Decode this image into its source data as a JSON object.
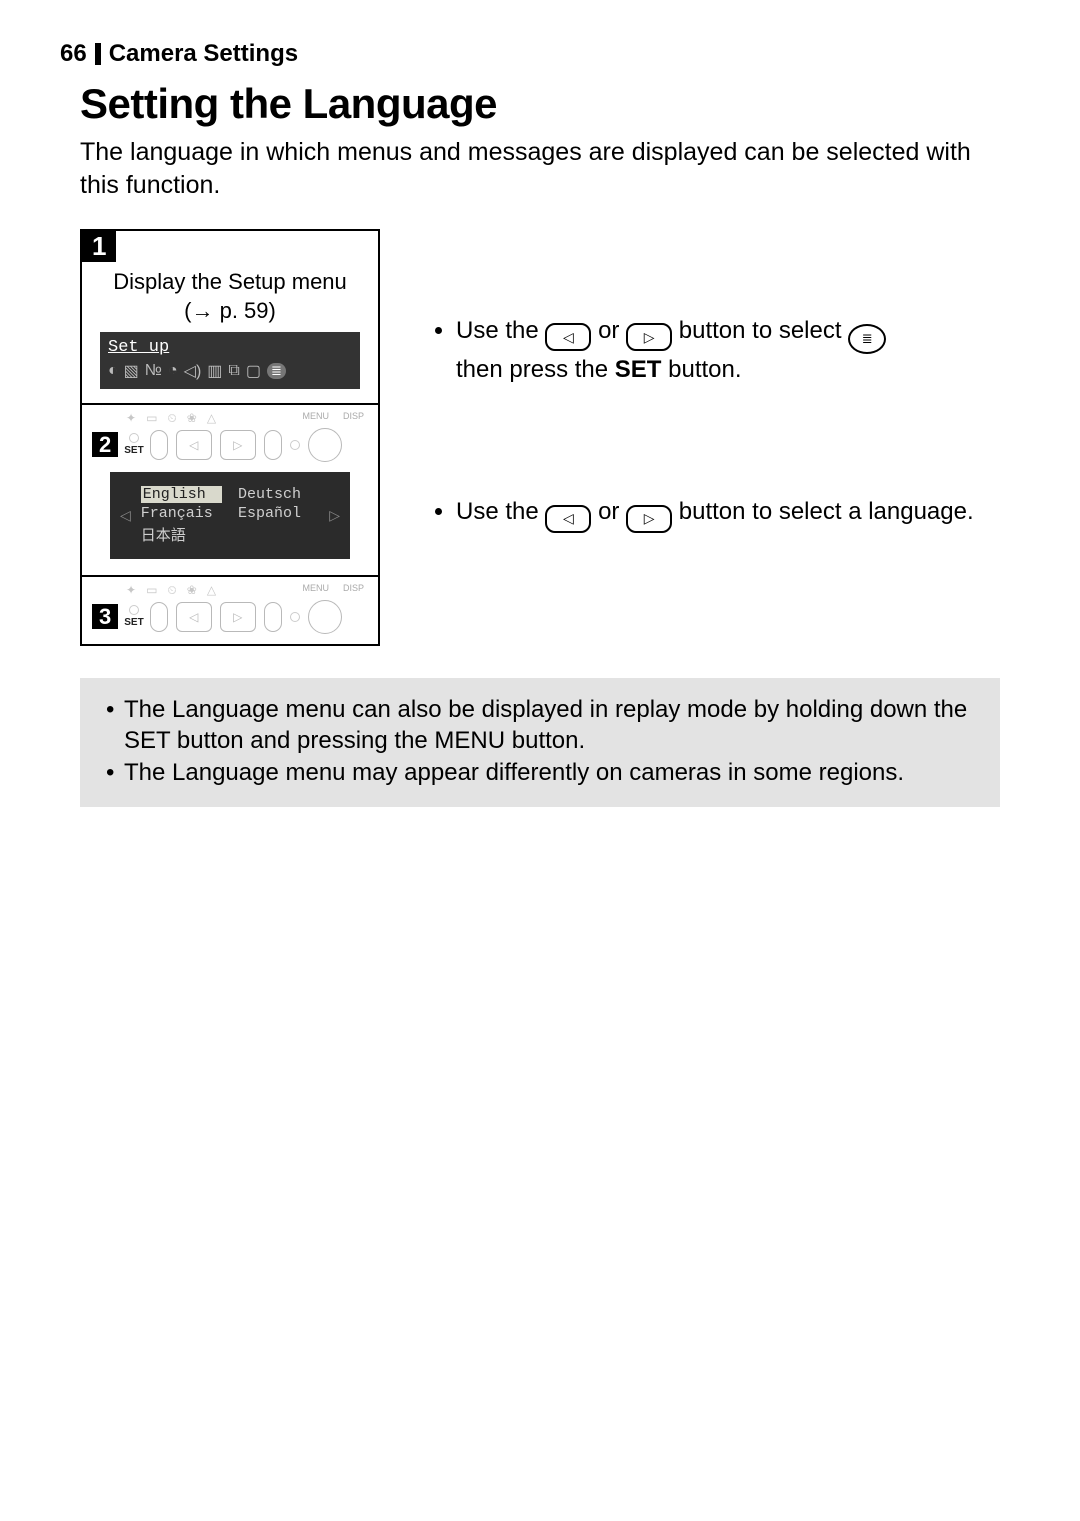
{
  "page_number": "66",
  "section": "Camera Settings",
  "title": "Setting the Language",
  "intro": "The language in which menus and messages are displayed can be selected with this function.",
  "steps": {
    "s1": {
      "badge": "1",
      "text": "Display the Setup menu",
      "ref_prefix": "(",
      "ref_arrow": "→",
      "ref_page": " p. 59)",
      "lcd_title": "Set up"
    },
    "s2": {
      "badge": "2",
      "set_label": "SET",
      "menu_label": "MENU",
      "disp_label": "DISP"
    },
    "languages": {
      "english": "English",
      "deutsch": "Deutsch",
      "francais": "Français",
      "espanol": "Español",
      "japanese": "日本語"
    },
    "s3": {
      "badge": "3",
      "set_label": "SET",
      "menu_label": "MENU",
      "disp_label": "DISP"
    }
  },
  "right": {
    "b1_pre": "Use the ",
    "b1_mid": " or ",
    "b1_post": " button to select ",
    "b1_tail1": "then press the ",
    "b1_set": "SET",
    "b1_tail2": " button.",
    "b2_pre": "Use the ",
    "b2_mid": " or ",
    "b2_post": " button to select a language."
  },
  "notes": {
    "n1": "The Language menu can also be displayed in replay mode by holding down the SET button and pressing the MENU button.",
    "n2": "The Language menu may appear differently on cameras in some regions."
  }
}
